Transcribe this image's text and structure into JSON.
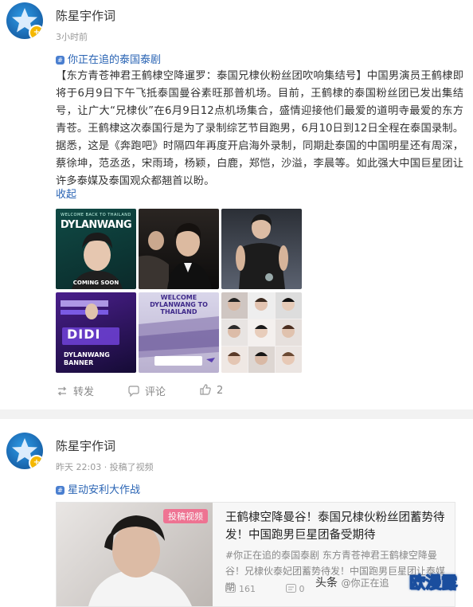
{
  "post1": {
    "author": "陈星宇作词",
    "time": "3小时前",
    "topic": "你正在追的泰国泰剧",
    "body": "【东方青苍神君王鹤棣空降暹罗：泰国兄棣伙粉丝团吹响集结号】中国男演员王鹤棣即将于6月9日下午飞抵泰国曼谷素旺那普机场。目前，王鹤棣的泰国粉丝团已发出集结号，让广大“兄棣伙”在6月9日12点机场集合，盛情迎接他们最爱的道明寺最爱的东方青苍。王鹤棣这次泰国行是为了录制综艺节目跑男，6月10日到12日全程在泰国录制。据悉，这是《奔跑吧》时隔四年再度开启海外录制，同期赴泰国的中国明星还有周深，蔡徐坤，范丞丞，宋雨琦，杨颖，白鹿，郑恺，沙溢，李晨等。如此强大中国巨星团让许多泰媒及泰国观众都翘首以盼。",
    "collapse": "收起",
    "images": [
      {
        "text_top": "WELCOME BACK TO THAILAND",
        "text_main": "DYLANWANG",
        "text_bottom": "COMING SOON"
      },
      {},
      {},
      {
        "text_main": "DIDI",
        "text_bottom": "DYLANWANG BANNER"
      },
      {
        "text_top": "WELCOME DYLANWANG TO THAILAND"
      },
      {}
    ],
    "actions": {
      "repost": "转发",
      "comment": "评论",
      "like": "2"
    }
  },
  "post2": {
    "author": "陈星宇作词",
    "time": "昨天 22:03 · 投稿了视频",
    "topic": "星动安利大作战",
    "card": {
      "tag": "投稿视频",
      "title": "王鹤棣空降曼谷！泰国兄棣伙粉丝团蓄势待发！中国跑男巨星团备受期待",
      "desc": "#你正在追的泰国泰剧 东方青苍神君王鹤棣空降曼谷！兄棣伙泰妃团蓄势待发！中国跑男巨星团让泰媒期",
      "plays": "161",
      "comments": "0"
    }
  },
  "watermarks": {
    "toutiao": "头条",
    "toutiao_sub": "@你正在追",
    "site": "欧漫露"
  },
  "colors": {
    "link": "#2a64b4",
    "divider": "#f2f2f2",
    "tag": "#f26a8d"
  }
}
